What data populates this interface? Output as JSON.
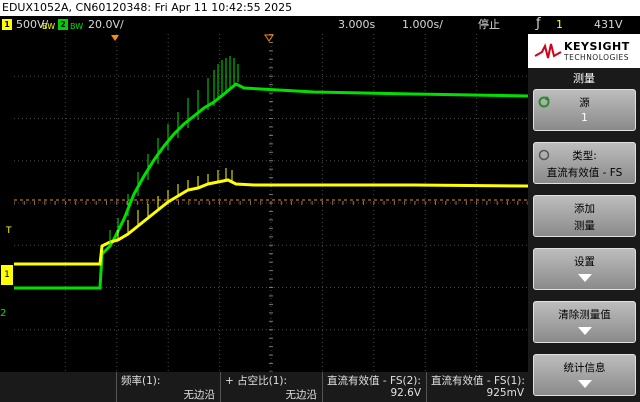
{
  "title_bar": "EDUX1052A, CN60120348: Fri Apr 11 10:42:55 2025",
  "status": {
    "ch1_number": "1",
    "ch1_scale": "500V/",
    "ch2_number": "2",
    "ch2_scale": "20.0V/",
    "bw_label": "BW",
    "time_delay": "3.000s",
    "time_scale": "1.000s/",
    "run_state": "停止",
    "trigger_icon": "rising-edge-icon",
    "trigger_source": "1",
    "trigger_level": "431V"
  },
  "colors": {
    "ch1": "#ffff00",
    "ch2": "#00e000",
    "grid": "#5a5a5a",
    "marker": "#ff8c00"
  },
  "sidebar": {
    "brand": "KEYSIGHT",
    "brand_sub": "TECHNOLOGIES",
    "menu_title": "测量",
    "buttons": [
      {
        "line1": "源",
        "line2": "1"
      },
      {
        "line1": "类型:",
        "line2": "直流有效值 - FS"
      },
      {
        "line1": "添加",
        "line2": "测量"
      },
      {
        "line1": "设置",
        "line2": ""
      },
      {
        "line1": "清除测量值",
        "line2": ""
      },
      {
        "line1": "统计信息",
        "line2": ""
      }
    ]
  },
  "measurements": [
    {
      "name": "频率(1):",
      "value": "无边沿"
    },
    {
      "name": "+ 占空比(1):",
      "value": "无边沿"
    },
    {
      "name": "直流有效值 - FS(2):",
      "value": "92.6V"
    },
    {
      "name": "直流有效值 - FS(1):",
      "value": "925mV"
    }
  ],
  "markers": {
    "ch1_marker": "1",
    "ch2_marker": "2",
    "trigger_marker": "T"
  }
}
